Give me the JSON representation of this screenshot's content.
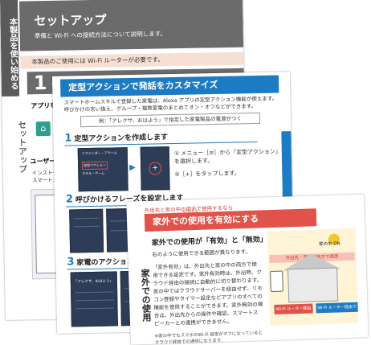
{
  "page1": {
    "side_tab": "本製品を使い始める",
    "title": "セットアップ",
    "subtitle": "準備と Wi-Fi への接続方法について説明します。",
    "note": "本製品のご使用には Wi-Fi ルーターが必要です。",
    "step_number": "1",
    "step_label": "セッ",
    "app_heading": "アプリをイ",
    "vertical_label": "セットアップ",
    "user_heading": "ユーザー登",
    "install_text_1": "インストール後",
    "install_text_2": "スマートスピー"
  },
  "page2": {
    "header": "定型アクションで発話をカスタマイズ",
    "intro": "スマートホームスキルで登録した家電は、Alexa アプリの定型アクション機能が使えます。呼びかけの言い換え、グループ・複数家電のまとめてオン・オフなどができます。",
    "example": "例：「アレクサ、おはよう」で指定した家電製品の電源がつく",
    "steps": [
      {
        "num": "1",
        "label": "定型アクションを作成します"
      },
      {
        "num": "2",
        "label": "呼びかけるフレーズを設定します"
      },
      {
        "num": "3",
        "label": "家電のアクションを設"
      }
    ],
    "step1_desc_1": "① メニュー［≡］から「定型アクション」を選択します。",
    "step1_desc_2": "②［+］をタップします。",
    "screen_texts": [
      "リマインダー・アラーム",
      "定型アクション",
      "スキル・ゲーム",
      "「アレクサ、おはよう」"
    ]
  },
  "page3": {
    "top_note": "外出先と家の中の両方で使用するなら",
    "header": "家外での使用を有効にする",
    "ruby": "いえそと",
    "subheading": "家外での使用が「有効」と「無効」の違い",
    "para1": "右のように使用できる範囲が異なります。",
    "para2": "「家外有効」は、外出先と家の中の両方で使用できる設定です。家外有効時は、外出時、クラウド経由の接続に自動的に切り替わります。家の中ではクラウドサーバーを経由せず、リモコン登録やタイマー設定などアプリのすべての機能を使用することができます。家外無効の場合は、外出先からの操作や確認、スマートスピーカーとの連携ができません。",
    "vertical_title": "家外での使用",
    "footnote": "※家の中でもスマホのWi-Fi 設定がオフになっているとクラウド経由での通信になります。",
    "diagram_ribbon": "外出先・家の中両方で使用",
    "diagram_home": "家の中 ON",
    "wifi_label_1": "Wi-Fi ルーター経由で通信",
    "wifi_label_2": "Wi-Fi ルーター経由で通信"
  }
}
